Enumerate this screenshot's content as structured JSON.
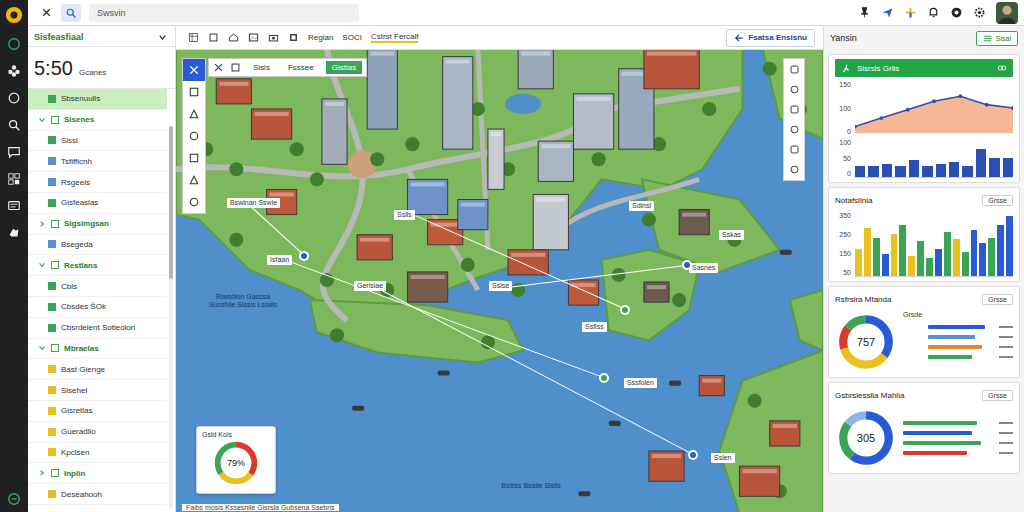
{
  "topbar": {
    "search": "Swsvin"
  },
  "left_panel": {
    "title": "Sisfeasfiaal",
    "time": "5:50",
    "time_label": "Gcanes",
    "items": [
      {
        "label": "Sbsenuulls",
        "kind": "item",
        "selected": true,
        "color": "#3aa655"
      },
      {
        "label": "Sisenes",
        "kind": "group",
        "expanded": true,
        "selected": false,
        "color": "#3aa655"
      },
      {
        "label": "Sissl",
        "kind": "item",
        "selected": false,
        "color": "#3aa655"
      },
      {
        "label": "Tsfifficnh",
        "kind": "item",
        "selected": false,
        "color": "#5b8fd6"
      },
      {
        "label": "Rsgeels",
        "kind": "item",
        "selected": false,
        "color": "#5b8fd6"
      },
      {
        "label": "Gisfeaslas",
        "kind": "item",
        "selected": false,
        "color": "#3aa655"
      },
      {
        "label": "Sigsimgsan",
        "kind": "group",
        "expanded": false,
        "selected": false,
        "color": "#3aa655"
      },
      {
        "label": "Bsegeda",
        "kind": "item",
        "selected": false,
        "color": "#5b8fd6"
      },
      {
        "label": "Restlans",
        "kind": "group",
        "expanded": true,
        "selected": false,
        "color": "#3aa655"
      },
      {
        "label": "Cbls",
        "kind": "item",
        "selected": false,
        "color": "#3aa655"
      },
      {
        "label": "Cbsdes ŠOk",
        "kind": "item",
        "selected": false,
        "color": "#3aa655"
      },
      {
        "label": "Cbsrdelent Sotieolon",
        "kind": "item",
        "selected": false,
        "color": "#3aa655"
      },
      {
        "label": "Mbraelas",
        "kind": "group",
        "expanded": true,
        "selected": false,
        "color": "#3aa655"
      },
      {
        "label": "Bast Gienge",
        "kind": "item",
        "selected": false,
        "color": "#e5c020"
      },
      {
        "label": "Sisehel",
        "kind": "item",
        "selected": false,
        "color": "#e5c020"
      },
      {
        "label": "Gisretlas",
        "kind": "item",
        "selected": false,
        "color": "#e5c020"
      },
      {
        "label": "Gueradlio",
        "kind": "item",
        "selected": false,
        "color": "#e5c020"
      },
      {
        "label": "Kpclsen",
        "kind": "item",
        "selected": false,
        "color": "#e5c020"
      },
      {
        "label": "Inplin",
        "kind": "group",
        "expanded": false,
        "selected": false,
        "color": "#3aa655"
      },
      {
        "label": "Deseahooh",
        "kind": "item",
        "selected": false,
        "color": "#e5c020"
      }
    ]
  },
  "center_toolbar": {
    "items": [
      "Regian",
      "SOCI",
      "Cstrst Fercalf"
    ],
    "button": "Fsatsa Ensisnu"
  },
  "map": {
    "tools": [
      {
        "selected": true
      },
      {
        "selected": false
      },
      {
        "selected": false
      },
      {
        "selected": false
      },
      {
        "selected": false
      },
      {
        "selected": false
      },
      {
        "selected": false
      }
    ],
    "tabs": [
      {
        "label": "Sisis",
        "selected": false
      },
      {
        "label": "Fsssee",
        "selected": false
      },
      {
        "label": "Gistlas",
        "selected": true
      }
    ],
    "labels": [
      "Bswlnan Sswle",
      "Sslls",
      "Isfaan",
      "Gerlsiae",
      "Sslse",
      "Sdinsl",
      "Sskas",
      "Sasnes",
      "Ssflss",
      "Sssfolen",
      "Sslen"
    ],
    "water_texts": [
      "Riwsdion Gasssa Susshiie Sissis Lsialis",
      "Bsitiss Bsalie Sislis"
    ],
    "pins": [
      {
        "color": "#2a5bd7"
      },
      {
        "color": "#3aa655"
      },
      {
        "color": "#3aa655"
      },
      {
        "color": "#2a5bd7"
      },
      {
        "color": "#2a5bd7"
      }
    ],
    "gauge": {
      "title": "Gsld Kois",
      "value": "79%",
      "segments": [
        {
          "value": 35,
          "color": "#d93a2b"
        },
        {
          "value": 30,
          "color": "#e8c31e"
        },
        {
          "value": 35,
          "color": "#3aa655"
        }
      ]
    },
    "footer": "Faibs mosis Kssesnlie Gisrsla Gubsena Ssebns"
  },
  "right_panel": {
    "title": "Yansin",
    "dropdown": "Sisal",
    "trend_card": {
      "title": "Sisrsls Grlis",
      "area": {
        "ticks": [
          "150",
          "100",
          "0"
        ],
        "values": [
          20,
          45,
          70,
          95,
          110,
          85,
          75
        ]
      },
      "bars": {
        "ticks": [
          "100",
          "50",
          "0"
        ],
        "values": [
          30,
          30,
          35,
          30,
          45,
          30,
          35,
          40,
          30,
          75,
          50,
          50
        ]
      }
    },
    "bar_card": {
      "title": "Notafslinia",
      "button": "Grsse",
      "ticks": [
        "350",
        "250",
        "150",
        "50"
      ],
      "bars": [
        {
          "value": 150,
          "color": "#e8c31e"
        },
        {
          "value": 260,
          "color": "#e8c31e"
        },
        {
          "value": 210,
          "color": "#3aa655"
        },
        {
          "value": 120,
          "color": "#2a5bd7"
        },
        {
          "value": 230,
          "color": "#e8c31e"
        },
        {
          "value": 280,
          "color": "#3aa655"
        },
        {
          "value": 110,
          "color": "#e8c31e"
        },
        {
          "value": 190,
          "color": "#3aa655"
        },
        {
          "value": 100,
          "color": "#3aa655"
        },
        {
          "value": 150,
          "color": "#2a5bd7"
        },
        {
          "value": 240,
          "color": "#3aa655"
        },
        {
          "value": 200,
          "color": "#e8c31e"
        },
        {
          "value": 130,
          "color": "#3aa655"
        },
        {
          "value": 250,
          "color": "#2a5bd7"
        },
        {
          "value": 180,
          "color": "#2a5bd7"
        },
        {
          "value": 210,
          "color": "#3aa655"
        },
        {
          "value": 280,
          "color": "#2a5bd7"
        },
        {
          "value": 330,
          "color": "#2a5bd7"
        }
      ]
    },
    "donut_cards": [
      {
        "title": "Rsfrsira Mfanda",
        "button": "Grsse",
        "value": "757",
        "legend_label": "Grsde",
        "segments": [
          {
            "value": 35,
            "color": "#2a5bd7"
          },
          {
            "value": 35,
            "color": "#e8c31e"
          },
          {
            "value": 15,
            "color": "#d93a2b"
          },
          {
            "value": 15,
            "color": "#3aa655"
          }
        ],
        "legend": [
          {
            "level": 0.85,
            "color": "#2a5bd7"
          },
          {
            "level": 0.7,
            "color": "#5b8fd6"
          },
          {
            "level": 0.8,
            "color": "#e8852e"
          },
          {
            "level": 0.65,
            "color": "#3aa655"
          }
        ]
      },
      {
        "title": "Gsbrslesslia Mahlia",
        "button": "Grsse",
        "value": "305",
        "legend_label": "",
        "segments": [
          {
            "value": 60,
            "color": "#2a5bd7"
          },
          {
            "value": 25,
            "color": "#3aa655"
          },
          {
            "value": 15,
            "color": "#8fb4e8"
          }
        ],
        "legend": [
          {
            "level": 0.8,
            "color": "#3aa655"
          },
          {
            "level": 0.75,
            "color": "#2a5bd7"
          },
          {
            "level": 0.85,
            "color": "#3aa655"
          },
          {
            "level": 0.7,
            "color": "#d93a2b"
          }
        ]
      }
    ]
  }
}
